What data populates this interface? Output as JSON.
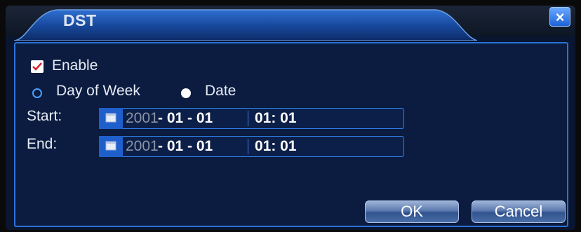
{
  "window": {
    "title": "DST",
    "close_label": "×"
  },
  "enable": {
    "label": "Enable",
    "checked": true
  },
  "mode": {
    "options": [
      {
        "label": "Day of Week",
        "selected": false
      },
      {
        "label": "Date",
        "selected": true
      }
    ]
  },
  "start": {
    "label": "Start:",
    "year": "2001",
    "date_rest": "- 01 - 01",
    "time": "01: 01"
  },
  "end": {
    "label": "End:",
    "year": "2001",
    "date_rest": "- 01 - 01",
    "time": "01: 01"
  },
  "buttons": {
    "ok": "OK",
    "cancel": "Cancel"
  },
  "colors": {
    "panel_border": "#2a73d8",
    "panel_bg": "#0b1c40",
    "accent": "#1f5fcc"
  }
}
